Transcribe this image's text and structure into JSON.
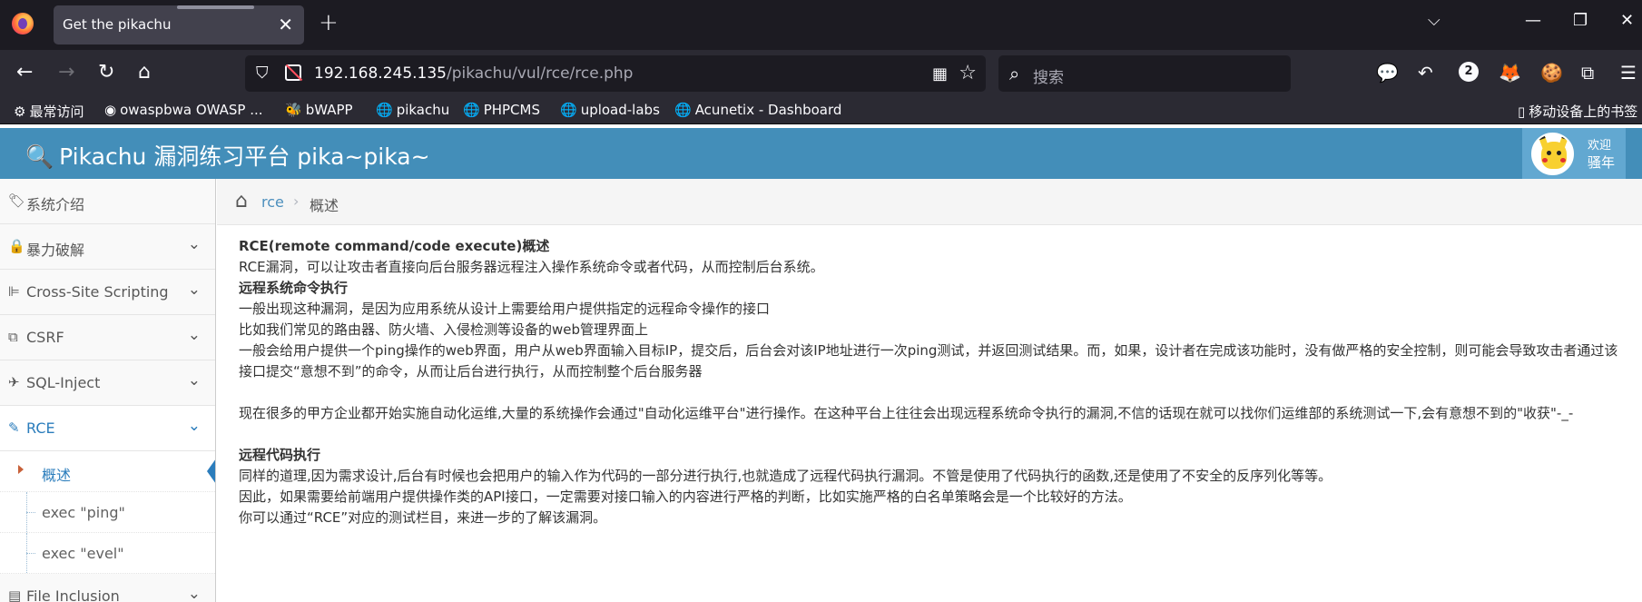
{
  "browser": {
    "tab_title": "Get the pikachu",
    "url_host": "192.168.245.135",
    "url_path": "/pikachu/vul/rce/rce.php",
    "search_placeholder": "搜索",
    "ext_badge": "2",
    "bookmarks": [
      {
        "label": "最常访问",
        "icon": "gear-icon"
      },
      {
        "label": "owaspbwa OWASP ...",
        "icon": "owasp-icon"
      },
      {
        "label": "bWAPP",
        "icon": "bee-icon"
      },
      {
        "label": "pikachu",
        "icon": "globe-icon"
      },
      {
        "label": "PHPCMS",
        "icon": "globe-icon"
      },
      {
        "label": "upload-labs",
        "icon": "globe-icon"
      },
      {
        "label": "Acunetix - Dashboard",
        "icon": "globe-icon"
      }
    ],
    "mobile_bookmarks": "移动设备上的书签"
  },
  "header": {
    "title": "Pikachu 漏洞练习平台 pika~pika~",
    "welcome": "欢迎",
    "username": "骚年"
  },
  "sidebar": {
    "items": [
      {
        "label": "系统介绍",
        "icon": "tags-icon"
      },
      {
        "label": "暴力破解",
        "icon": "lock-icon"
      },
      {
        "label": "Cross-Site Scripting",
        "icon": "sitemap-icon"
      },
      {
        "label": "CSRF",
        "icon": "share-icon"
      },
      {
        "label": "SQL-Inject",
        "icon": "fighter-jet-icon"
      },
      {
        "label": "RCE",
        "icon": "pencil-icon"
      },
      {
        "label": "File Inclusion",
        "icon": "file-icon"
      }
    ],
    "sub_items": [
      "概述",
      "exec \"ping\"",
      "exec \"evel\""
    ]
  },
  "breadcrumb": {
    "parent": "rce",
    "current": "概述"
  },
  "content": {
    "h1": "RCE(remote command/code execute)概述",
    "p1": "RCE漏洞，可以让攻击者直接向后台服务器远程注入操作系统命令或者代码，从而控制后台系统。",
    "h2": "远程系统命令执行",
    "p2": "一般出现这种漏洞，是因为应用系统从设计上需要给用户提供指定的远程命令操作的接口",
    "p3": "比如我们常见的路由器、防火墙、入侵检测等设备的web管理界面上",
    "p4": "一般会给用户提供一个ping操作的web界面，用户从web界面输入目标IP，提交后，后台会对该IP地址进行一次ping测试，并返回测试结果。而，如果，设计者在完成该功能时，没有做严格的安全控制，则可能会导致攻击者通过该接口提交“意想不到”的命令，从而让后台进行执行，从而控制整个后台服务器",
    "p5": "现在很多的甲方企业都开始实施自动化运维,大量的系统操作会通过\"自动化运维平台\"进行操作。在这种平台上往往会出现远程系统命令执行的漏洞,不信的话现在就可以找你们运维部的系统测试一下,会有意想不到的\"收获\"-_-",
    "h3": "远程代码执行",
    "p6": "同样的道理,因为需求设计,后台有时候也会把用户的输入作为代码的一部分进行执行,也就造成了远程代码执行漏洞。不管是使用了代码执行的函数,还是使用了不安全的反序列化等等。",
    "p7": "因此，如果需要给前端用户提供操作类的API接口，一定需要对接口输入的内容进行严格的判断，比如实施严格的白名单策略会是一个比较好的方法。",
    "p8": "你可以通过“RCE”对应的测试栏目，来进一步的了解该漏洞。"
  },
  "colors": {
    "header_blue": "#438eb9",
    "link_blue": "#2b7dbc",
    "browser_dark": "#1c1b22"
  }
}
